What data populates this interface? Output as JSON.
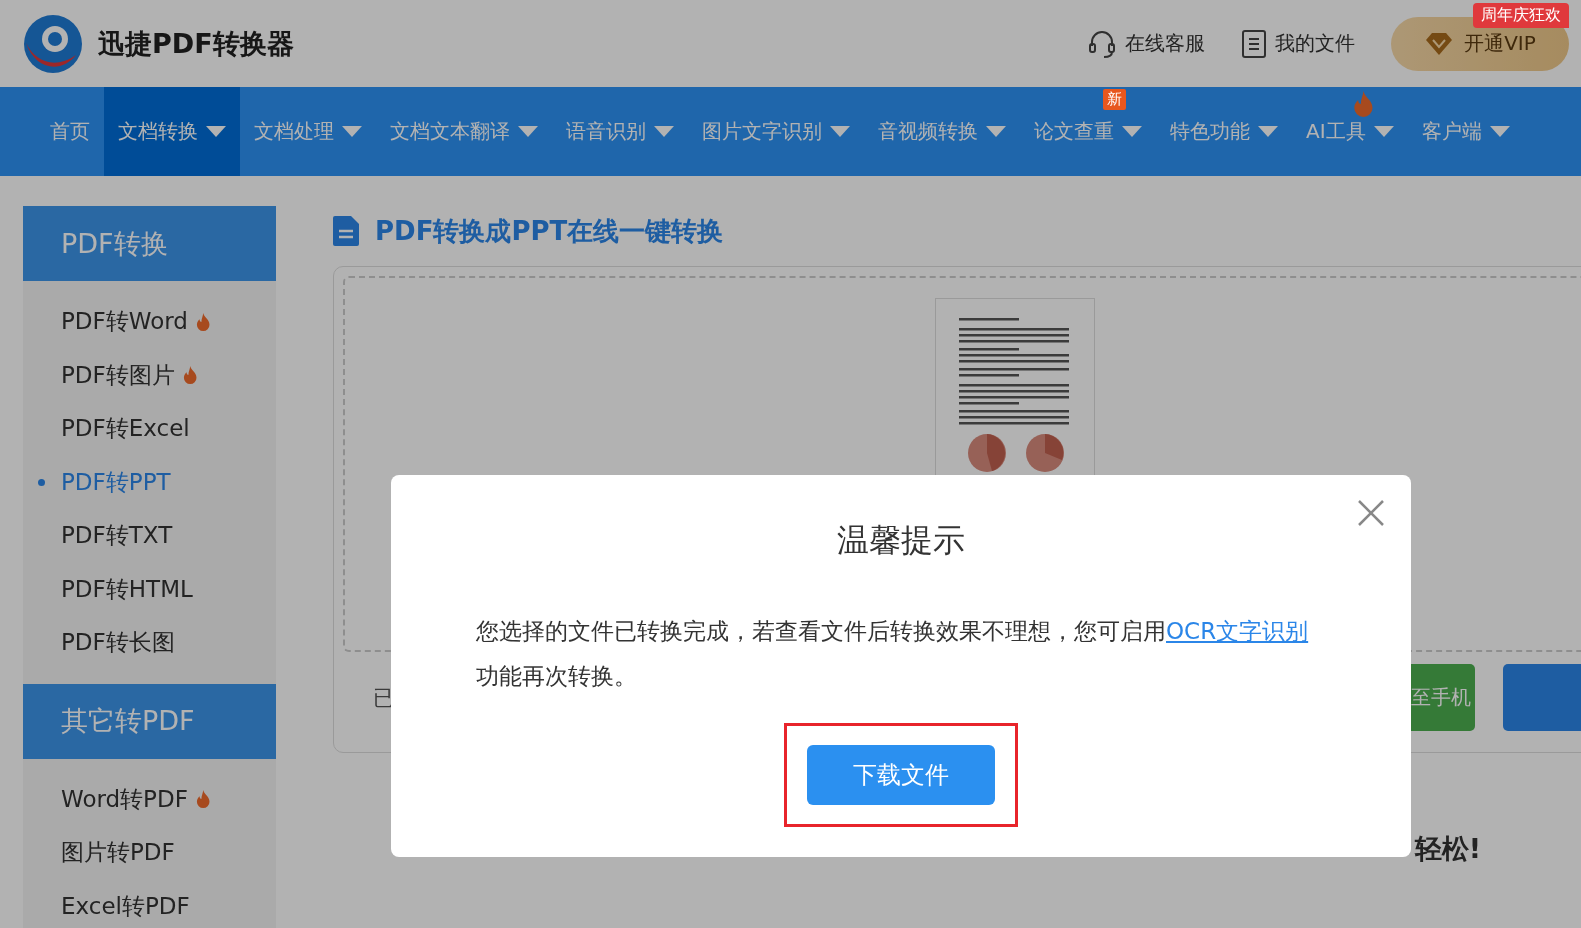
{
  "header": {
    "brand": "迅捷PDF转换器",
    "links": [
      {
        "label": "在线客服",
        "kind": "support"
      },
      {
        "label": "我的文件",
        "kind": "files"
      }
    ],
    "vip": {
      "label": "开通VIP",
      "badge": "周年庆狂欢"
    }
  },
  "nav": [
    {
      "label": "首页",
      "selected": false,
      "dropdown": false
    },
    {
      "label": "文档转换",
      "selected": true,
      "dropdown": true
    },
    {
      "label": "文档处理",
      "selected": false,
      "dropdown": true
    },
    {
      "label": "文档文本翻译",
      "selected": false,
      "dropdown": true
    },
    {
      "label": "语音识别",
      "selected": false,
      "dropdown": true
    },
    {
      "label": "图片文字识别",
      "selected": false,
      "dropdown": true
    },
    {
      "label": "音视频转换",
      "selected": false,
      "dropdown": true
    },
    {
      "label": "论文查重",
      "selected": false,
      "dropdown": true,
      "badge": "新"
    },
    {
      "label": "特色功能",
      "selected": false,
      "dropdown": true
    },
    {
      "label": "AI工具",
      "selected": false,
      "dropdown": true,
      "hot": true
    },
    {
      "label": "客户端",
      "selected": false,
      "dropdown": true
    }
  ],
  "sidebar": [
    {
      "title": "PDF转换",
      "items": [
        {
          "label": "PDF转Word",
          "hot": true,
          "selected": false
        },
        {
          "label": "PDF转图片",
          "hot": true,
          "selected": false
        },
        {
          "label": "PDF转Excel",
          "hot": false,
          "selected": false
        },
        {
          "label": "PDF转PPT",
          "hot": false,
          "selected": true
        },
        {
          "label": "PDF转TXT",
          "hot": false,
          "selected": false
        },
        {
          "label": "PDF转HTML",
          "hot": false,
          "selected": false
        },
        {
          "label": "PDF转长图",
          "hot": false,
          "selected": false
        }
      ]
    },
    {
      "title": "其它转PDF",
      "items": [
        {
          "label": "Word转PDF",
          "hot": true,
          "selected": false
        },
        {
          "label": "图片转PDF",
          "hot": false,
          "selected": false
        },
        {
          "label": "Excel转PDF",
          "hot": false,
          "selected": false
        }
      ]
    }
  ],
  "main": {
    "title": "PDF转换成PPT在线一键转换",
    "status_text": "已",
    "phone_button": "至手机",
    "footer_text": "轻松!"
  },
  "dialog": {
    "title": "温馨提示",
    "message": "您选择的文件已转换完成，若查看文件后转换效果不理想，您可启用",
    "link": "OCR文字识别",
    "message_end": "功能再次转换。",
    "button": "下载文件",
    "highlighted": true
  }
}
